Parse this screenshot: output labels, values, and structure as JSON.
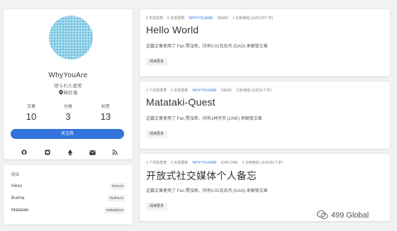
{
  "profile": {
    "name": "WhyYouAre",
    "tagline": "捨られた虚実",
    "location": "碎片海",
    "stats": [
      {
        "label": "文章",
        "value": "10"
      },
      {
        "label": "分类",
        "value": "3"
      },
      {
        "label": "标签",
        "value": "13"
      }
    ],
    "follow_label": "关注我",
    "social_icons": [
      "github-icon",
      "matataki-icon",
      "ethereum-icon",
      "mail-icon",
      "rss-icon"
    ]
  },
  "links": {
    "title": "链接",
    "items": [
      {
        "name": "Hexo",
        "url": "hexo.io"
      },
      {
        "name": "Bulma",
        "url": "bulma.io"
      },
      {
        "name": "Matataki",
        "url": "matataki.io"
      }
    ]
  },
  "posts": [
    {
      "published": "6 天前发表",
      "updated": "6 天前更新",
      "author": "WHYYOUARE",
      "category": "DEMO",
      "reading": "1 分钟读完 (大约123个字)",
      "title": "Hello World",
      "excerpt": "这篇文章使用了 Fan 票加密，持有0.01岛岛币 (DAO) 来解锁文章",
      "more": "阅读更多"
    },
    {
      "published": "1 个月前发表",
      "updated": "6 天前更新",
      "author": "WHYYOUARE",
      "category": "DEMO",
      "reading": "几秒读完 (大约11个字)",
      "title": "Matataki-Quest",
      "excerpt": "这篇文章使用了 Fan 票加密，持有1林可币 (LINK) 来解锁文章",
      "more": "阅读更多"
    },
    {
      "published": "1 个月前发表",
      "updated": "6 天前更新",
      "author": "WHYYOUARE",
      "category": "EXPLORE",
      "reading": "2 分钟读完 (大约251个字)",
      "title": "开放式社交媒体个人备忘",
      "excerpt": "这篇文章使用了 Fan 票加密，持有0.01岛岛币 (DAO) 来解锁文章",
      "more": "阅读更多"
    }
  ],
  "watermark": "499 Global",
  "colors": {
    "accent": "#3273dc",
    "background": "#f2f2f2"
  }
}
